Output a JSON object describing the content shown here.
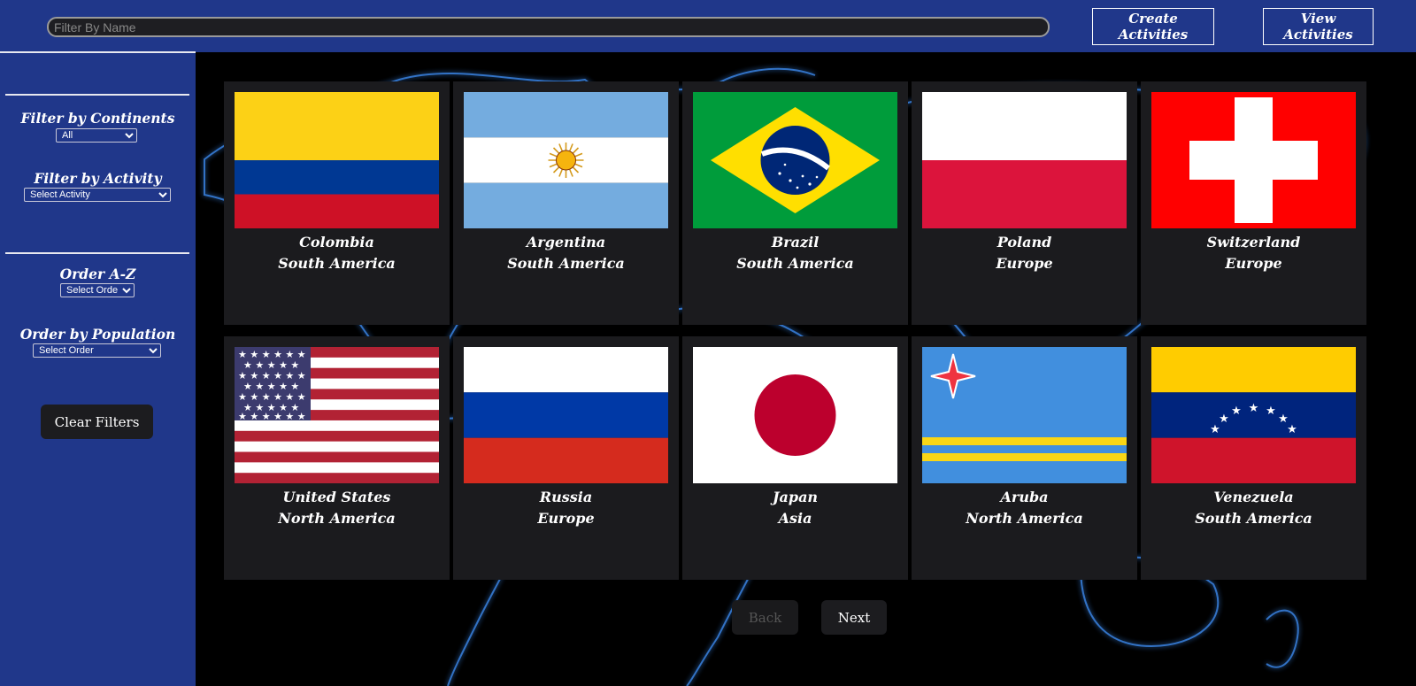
{
  "header": {
    "search_placeholder": "Filter By Name",
    "create_label": "Create Activities",
    "view_label": "View Activities"
  },
  "sidebar": {
    "continents_label": "Filter by Continents",
    "continents_value": "All",
    "activity_label": "Filter by Activity",
    "activity_value": "Select Activity",
    "order_az_label": "Order A-Z",
    "order_az_value": "Select Order",
    "order_pop_label": "Order by Population",
    "order_pop_value": "Select Order",
    "clear_label": "Clear Filters"
  },
  "countries": [
    {
      "name": "Colombia",
      "continent": "South America",
      "flag": "colombia-flag"
    },
    {
      "name": "Argentina",
      "continent": "South America",
      "flag": "argentina-flag"
    },
    {
      "name": "Brazil",
      "continent": "South America",
      "flag": "brazil-flag"
    },
    {
      "name": "Poland",
      "continent": "Europe",
      "flag": "poland-flag"
    },
    {
      "name": "Switzerland",
      "continent": "Europe",
      "flag": "switzerland-flag"
    },
    {
      "name": "United States",
      "continent": "North America",
      "flag": "usa-flag"
    },
    {
      "name": "Russia",
      "continent": "Europe",
      "flag": "russia-flag"
    },
    {
      "name": "Japan",
      "continent": "Asia",
      "flag": "japan-flag"
    },
    {
      "name": "Aruba",
      "continent": "North America",
      "flag": "aruba-flag"
    },
    {
      "name": "Venezuela",
      "continent": "South America",
      "flag": "venezuela-flag"
    }
  ],
  "pagination": {
    "back_label": "Back",
    "next_label": "Next"
  },
  "colors": {
    "bar": "#20378a",
    "card": "#1b1b1e",
    "map_glow": "#3a86e8"
  }
}
